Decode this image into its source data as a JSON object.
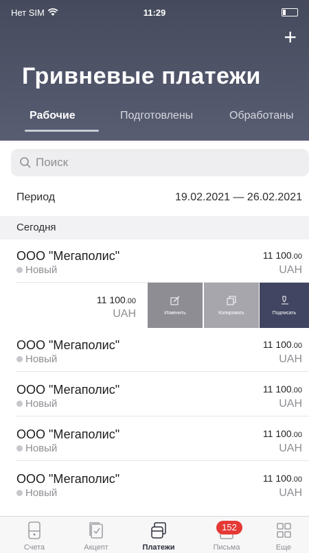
{
  "status_bar": {
    "carrier": "Нет SIM",
    "time": "11:29"
  },
  "header": {
    "title": "Гривневые платежи",
    "add_icon": "plus-icon",
    "tabs": [
      {
        "label": "Рабочие",
        "active": true
      },
      {
        "label": "Подготовлены",
        "active": false
      },
      {
        "label": "Обработаны",
        "active": false
      }
    ]
  },
  "search": {
    "placeholder": "Поиск"
  },
  "period": {
    "label": "Период",
    "range": "19.02.2021 — 26.02.2021"
  },
  "section": {
    "label": "Сегодня"
  },
  "payments": [
    {
      "name": "ООО \"Мегаполис\"",
      "status": "Новый",
      "amount_main": "11 100",
      "amount_cents": ".00",
      "currency": "UAH"
    },
    {
      "name": "ООО \"Мегаполис\"",
      "status": "Новый",
      "amount_main": "11 100",
      "amount_cents": ".00",
      "currency": "UAH"
    },
    {
      "name": "ООО \"Мегаполис\"",
      "status": "Новый",
      "amount_main": "11 100",
      "amount_cents": ".00",
      "currency": "UAH"
    },
    {
      "name": "ООО \"Мегаполис\"",
      "status": "Новый",
      "amount_main": "11 100",
      "amount_cents": ".00",
      "currency": "UAH"
    },
    {
      "name": "ООО \"Мегаполис\"",
      "status": "Новый",
      "amount_main": "11 100",
      "amount_cents": ".00",
      "currency": "UAH"
    }
  ],
  "swiped_row": {
    "amount_main": "11 100",
    "amount_cents": ".00",
    "currency": "UAH",
    "actions": [
      {
        "label": "Изменить",
        "icon": "edit-icon"
      },
      {
        "label": "Копировать",
        "icon": "copy-icon"
      },
      {
        "label": "Подписать",
        "icon": "sign-icon"
      }
    ]
  },
  "tabbar": {
    "items": [
      {
        "label": "Счета",
        "icon": "accounts-icon",
        "active": false
      },
      {
        "label": "Акцепт",
        "icon": "accept-icon",
        "active": false
      },
      {
        "label": "Платежи",
        "icon": "payments-icon",
        "active": true
      },
      {
        "label": "Письма",
        "icon": "letters-icon",
        "active": false
      },
      {
        "label": "Еще",
        "icon": "more-icon",
        "active": false
      }
    ],
    "letters_badge": "152"
  },
  "colors": {
    "header": "#4f5468",
    "sign_action": "#414561",
    "badge": "#e53935"
  }
}
